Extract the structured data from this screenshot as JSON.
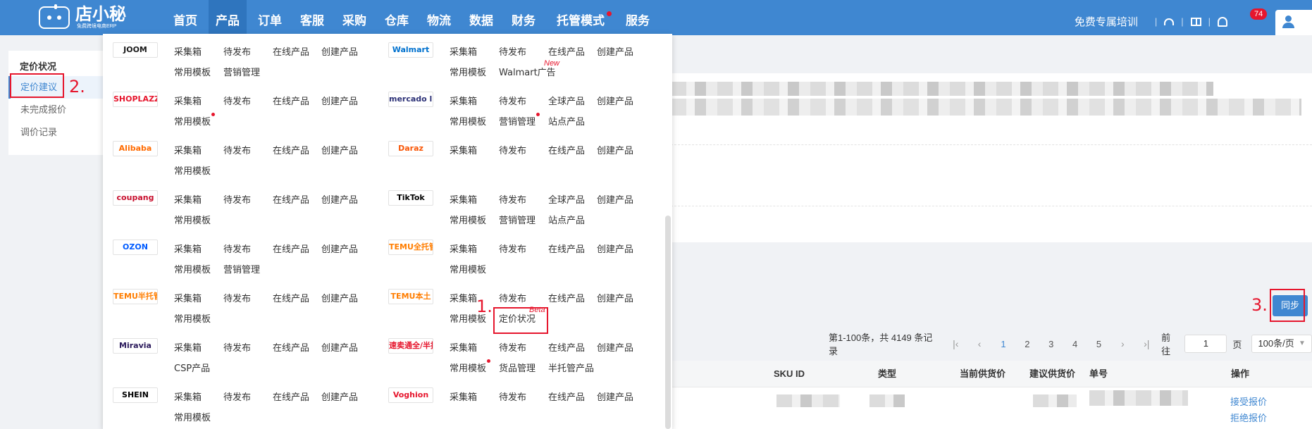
{
  "logo": {
    "name": "店小秘",
    "sub": "免费跨境电商ERP"
  },
  "nav": [
    {
      "label": "首页"
    },
    {
      "label": "产品",
      "active": true
    },
    {
      "label": "订单"
    },
    {
      "label": "客服"
    },
    {
      "label": "采购"
    },
    {
      "label": "仓库"
    },
    {
      "label": "物流"
    },
    {
      "label": "数据"
    },
    {
      "label": "财务"
    },
    {
      "label": "托管模式",
      "dot": true
    },
    {
      "label": "服务"
    }
  ],
  "topright": {
    "training": "免费专属培训",
    "sep": "|",
    "badge": "74"
  },
  "sidebar": {
    "title": "定价状况",
    "items": [
      "定价建议",
      "未完成报价",
      "调价记录"
    ]
  },
  "annotations": {
    "a1": "1.",
    "a2": "2.",
    "a3": "3."
  },
  "dropdown": {
    "left": [
      {
        "platform": "JOOM",
        "color": "#1a1a1a",
        "items": [
          [
            "采集箱",
            "待发布",
            "在线产品",
            "创建产品"
          ],
          [
            "常用模板",
            "营销管理"
          ]
        ]
      },
      {
        "platform": "SHOPLAZZA",
        "color": "#e6162d",
        "items": [
          [
            "采集箱",
            "待发布",
            "在线产品",
            "创建产品"
          ],
          [
            "常用模板"
          ]
        ]
      },
      {
        "platform": "Alibaba",
        "color": "#ff6a00",
        "items": [
          [
            "采集箱",
            "待发布",
            "在线产品",
            "创建产品"
          ],
          [
            "常用模板"
          ]
        ]
      },
      {
        "platform": "coupang",
        "color": "#c8102e",
        "items": [
          [
            "采集箱",
            "待发布",
            "在线产品",
            "创建产品"
          ],
          [
            "常用模板"
          ]
        ]
      },
      {
        "platform": "OZON",
        "color": "#005bff",
        "items": [
          [
            "采集箱",
            "待发布",
            "在线产品",
            "创建产品"
          ],
          [
            "常用模板",
            "营销管理"
          ]
        ]
      },
      {
        "platform": "TEMU半托管",
        "color": "#ff7d00",
        "items": [
          [
            "采集箱",
            "待发布",
            "在线产品",
            "创建产品"
          ],
          [
            "常用模板"
          ]
        ]
      },
      {
        "platform": "Miravia",
        "color": "#2b1a5c",
        "items": [
          [
            "采集箱",
            "待发布",
            "在线产品",
            "创建产品"
          ],
          [
            "CSP产品"
          ]
        ]
      },
      {
        "platform": "SHEIN",
        "color": "#000000",
        "items": [
          [
            "采集箱",
            "待发布",
            "在线产品",
            "创建产品"
          ],
          [
            "常用模板"
          ]
        ]
      }
    ],
    "right": [
      {
        "platform": "Walmart",
        "color": "#0071ce",
        "items": [
          [
            "采集箱",
            "待发布",
            "在线产品",
            "创建产品"
          ],
          [
            "常用模板",
            "Walmart广告"
          ]
        ]
      },
      {
        "platform": "mercado libre",
        "color": "#2d3277",
        "items": [
          [
            "采集箱",
            "待发布",
            "全球产品",
            "创建产品"
          ],
          [
            "常用模板",
            "营销管理",
            "站点产品"
          ]
        ]
      },
      {
        "platform": "Daraz",
        "color": "#f85606",
        "items": [
          [
            "采集箱",
            "待发布",
            "在线产品",
            "创建产品"
          ]
        ]
      },
      {
        "platform": "TikTok",
        "color": "#000000",
        "items": [
          [
            "采集箱",
            "待发布",
            "全球产品",
            "创建产品"
          ],
          [
            "常用模板",
            "营销管理",
            "站点产品"
          ]
        ]
      },
      {
        "platform": "TEMU全托管",
        "color": "#ff7d00",
        "items": [
          [
            "采集箱",
            "待发布",
            "在线产品",
            "创建产品"
          ],
          [
            "常用模板"
          ]
        ]
      },
      {
        "platform": "TEMU本土",
        "color": "#ff7d00",
        "items": [
          [
            "采集箱",
            "待发布",
            "在线产品",
            "创建产品"
          ],
          [
            "常用模板",
            "定价状况"
          ]
        ]
      },
      {
        "platform": "速卖通全/半托管",
        "color": "#e6162d",
        "items": [
          [
            "采集箱",
            "待发布",
            "在线产品",
            "创建产品"
          ],
          [
            "常用模板",
            "货品管理",
            "半托管产品"
          ]
        ]
      },
      {
        "platform": "Voghion",
        "color": "#e6162d",
        "items": [
          [
            "采集箱",
            "待发布",
            "在线产品",
            "创建产品"
          ]
        ]
      }
    ],
    "new_tag": "New",
    "beta_tag": "Beta"
  },
  "sync_button": "同步",
  "pager": {
    "summary": "第1-100条，共 4149 条记录",
    "pages": [
      "1",
      "2",
      "3",
      "4",
      "5"
    ],
    "goto_label": "前往",
    "goto_value": "1",
    "page_unit": "页",
    "size": "100条/页"
  },
  "table": {
    "headers": [
      "SKU ID",
      "类型",
      "当前供货价",
      "建议供货价",
      "单号",
      "操作"
    ],
    "actions": [
      "接受报价",
      "拒绝报价"
    ]
  }
}
